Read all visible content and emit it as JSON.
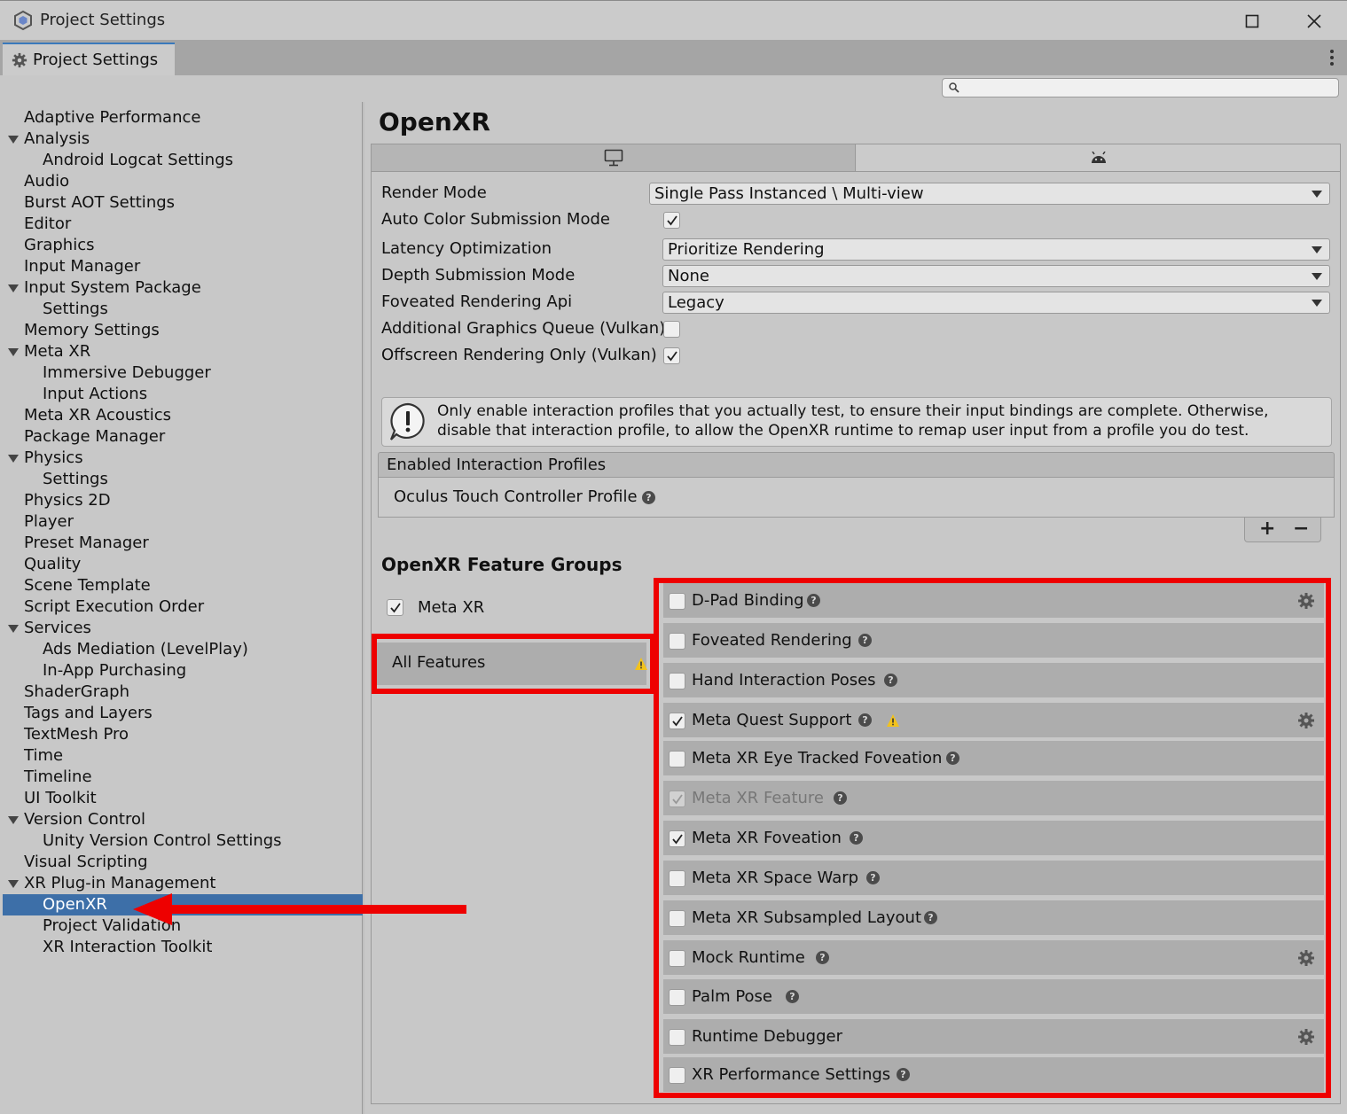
{
  "window": {
    "title": "Project Settings"
  },
  "tab": {
    "label": "Project Settings"
  },
  "search": {
    "placeholder": ""
  },
  "nav": [
    {
      "label": "Adaptive Performance",
      "level": 0,
      "expanded": null
    },
    {
      "label": "Analysis",
      "level": 0,
      "expanded": true
    },
    {
      "label": "Android Logcat Settings",
      "level": 1,
      "expanded": null
    },
    {
      "label": "Audio",
      "level": 0,
      "expanded": null
    },
    {
      "label": "Burst AOT Settings",
      "level": 0,
      "expanded": null
    },
    {
      "label": "Editor",
      "level": 0,
      "expanded": null
    },
    {
      "label": "Graphics",
      "level": 0,
      "expanded": null
    },
    {
      "label": "Input Manager",
      "level": 0,
      "expanded": null
    },
    {
      "label": "Input System Package",
      "level": 0,
      "expanded": true
    },
    {
      "label": "Settings",
      "level": 1,
      "expanded": null
    },
    {
      "label": "Memory Settings",
      "level": 0,
      "expanded": null
    },
    {
      "label": "Meta XR",
      "level": 0,
      "expanded": true
    },
    {
      "label": "Immersive Debugger",
      "level": 1,
      "expanded": null
    },
    {
      "label": "Input Actions",
      "level": 1,
      "expanded": null
    },
    {
      "label": "Meta XR Acoustics",
      "level": 0,
      "expanded": null
    },
    {
      "label": "Package Manager",
      "level": 0,
      "expanded": null
    },
    {
      "label": "Physics",
      "level": 0,
      "expanded": true
    },
    {
      "label": "Settings",
      "level": 1,
      "expanded": null
    },
    {
      "label": "Physics 2D",
      "level": 0,
      "expanded": null
    },
    {
      "label": "Player",
      "level": 0,
      "expanded": null
    },
    {
      "label": "Preset Manager",
      "level": 0,
      "expanded": null
    },
    {
      "label": "Quality",
      "level": 0,
      "expanded": null
    },
    {
      "label": "Scene Template",
      "level": 0,
      "expanded": null
    },
    {
      "label": "Script Execution Order",
      "level": 0,
      "expanded": null
    },
    {
      "label": "Services",
      "level": 0,
      "expanded": true
    },
    {
      "label": "Ads Mediation (LevelPlay)",
      "level": 1,
      "expanded": null
    },
    {
      "label": "In-App Purchasing",
      "level": 1,
      "expanded": null
    },
    {
      "label": "ShaderGraph",
      "level": 0,
      "expanded": null
    },
    {
      "label": "Tags and Layers",
      "level": 0,
      "expanded": null
    },
    {
      "label": "TextMesh Pro",
      "level": 0,
      "expanded": null
    },
    {
      "label": "Time",
      "level": 0,
      "expanded": null
    },
    {
      "label": "Timeline",
      "level": 0,
      "expanded": null
    },
    {
      "label": "UI Toolkit",
      "level": 0,
      "expanded": null
    },
    {
      "label": "Version Control",
      "level": 0,
      "expanded": true
    },
    {
      "label": "Unity Version Control Settings",
      "level": 1,
      "expanded": null
    },
    {
      "label": "Visual Scripting",
      "level": 0,
      "expanded": null
    },
    {
      "label": "XR Plug-in Management",
      "level": 0,
      "expanded": true
    },
    {
      "label": "OpenXR",
      "level": 1,
      "expanded": null,
      "selected": true
    },
    {
      "label": "Project Validation",
      "level": 1,
      "expanded": null
    },
    {
      "label": "XR Interaction Toolkit",
      "level": 1,
      "expanded": null
    }
  ],
  "main": {
    "title": "OpenXR",
    "platform_tabs": [
      "desktop-icon",
      "android-icon"
    ],
    "settings": {
      "render_mode_label": "Render Mode",
      "render_mode_value": "Single Pass Instanced \\ Multi-view",
      "auto_color_label": "Auto Color Submission Mode",
      "auto_color_checked": true,
      "latency_label": "Latency Optimization",
      "latency_value": "Prioritize Rendering",
      "depth_label": "Depth Submission Mode",
      "depth_value": "None",
      "foveated_api_label": "Foveated Rendering Api",
      "foveated_api_value": "Legacy",
      "additional_queue_label": "Additional Graphics Queue (Vulkan)",
      "additional_queue_checked": false,
      "offscreen_label": "Offscreen Rendering Only (Vulkan)",
      "offscreen_checked": true
    },
    "helpbox": "Only enable interaction profiles that you actually test, to ensure their input bindings are complete. Otherwise, disable that interaction profile, to allow the OpenXR runtime to remap user input from a profile you do test.",
    "profiles": {
      "header": "Enabled Interaction Profiles",
      "items": [
        "Oculus Touch Controller Profile"
      ]
    },
    "feature_groups": {
      "title": "OpenXR Feature Groups",
      "groups": [
        {
          "label": "Meta XR",
          "checked": true
        }
      ],
      "all_features_label": "All Features"
    },
    "features": [
      {
        "label": "D-Pad Binding",
        "checked": false,
        "gear": true,
        "warning": false,
        "disabled": false
      },
      {
        "label": "Foveated Rendering",
        "checked": false,
        "gear": false,
        "warning": false,
        "disabled": false
      },
      {
        "label": "Hand Interaction Poses",
        "checked": false,
        "gear": false,
        "warning": false,
        "disabled": false
      },
      {
        "label": "Meta Quest Support",
        "checked": true,
        "gear": true,
        "warning": true,
        "disabled": false
      },
      {
        "label": "Meta XR Eye Tracked Foveation",
        "checked": false,
        "gear": false,
        "warning": false,
        "disabled": false
      },
      {
        "label": "Meta XR Feature",
        "checked": true,
        "gear": false,
        "warning": false,
        "disabled": true
      },
      {
        "label": "Meta XR Foveation",
        "checked": true,
        "gear": false,
        "warning": false,
        "disabled": false
      },
      {
        "label": "Meta XR Space Warp",
        "checked": false,
        "gear": false,
        "warning": false,
        "disabled": false
      },
      {
        "label": "Meta XR Subsampled Layout",
        "checked": false,
        "gear": false,
        "warning": false,
        "disabled": false
      },
      {
        "label": "Mock Runtime",
        "checked": false,
        "gear": true,
        "warning": false,
        "disabled": false
      },
      {
        "label": "Palm Pose",
        "checked": false,
        "gear": false,
        "warning": false,
        "disabled": false
      },
      {
        "label": "Runtime Debugger",
        "checked": false,
        "gear": true,
        "warning": false,
        "disabled": false
      },
      {
        "label": "XR Performance Settings",
        "checked": false,
        "gear": false,
        "warning": false,
        "disabled": false
      }
    ]
  },
  "colors": {
    "highlight": "#ee0000",
    "selection": "#3d6fa8",
    "warning": "#f2c21b"
  }
}
